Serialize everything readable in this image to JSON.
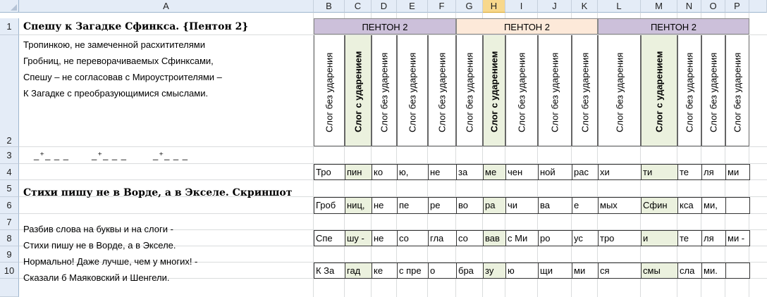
{
  "columns": [
    "A",
    "B",
    "C",
    "D",
    "E",
    "F",
    "G",
    "H",
    "I",
    "J",
    "K",
    "L",
    "M",
    "N",
    "O",
    "P"
  ],
  "selected_column": "H",
  "rows": [
    "1",
    "2",
    "3",
    "4",
    "5",
    "6",
    "7",
    "8",
    "9",
    "10"
  ],
  "cells": {
    "a1": "Спешу к Загадке Сфинкса. {Пентон 2}",
    "poem": [
      "Тропинкою, не замеченной расхитителями",
      "Гробниц, не переворачиваемых Сфинксами,",
      "Спешу – не согласовав с Мироустроителями –",
      "К Загадке с преобразующимися смыслами."
    ],
    "a3_meter": [
      "_⁺_ _ _",
      "_⁺_ _ _",
      "_⁺_ _ _"
    ],
    "a5": "Стихи пишу не в  Ворде,  а  в  Экселе. Скриншот",
    "a7": "Разбив слова на буквы и на слоги -",
    "a8": "Стихи пишу не в Ворде, а в Экселе.",
    "a9": "Нормально! Даже лучше, чем у многих! -",
    "a10": "Сказали  б  Маяковский и Шенгели."
  },
  "banners": [
    "ПЕНТОН 2",
    "ПЕНТОН 2",
    "ПЕНТОН 2"
  ],
  "vertical_labels": {
    "unstressed": "Слог  без  ударения",
    "stressed": "Слог  с  ударением"
  },
  "syllable_rows": {
    "r4": [
      "Тро",
      "пин",
      "ко",
      "ю,",
      "не",
      "за",
      "ме",
      "чен",
      "ной",
      "рас",
      "хи",
      "ти",
      "те",
      "ля",
      "ми"
    ],
    "r6": [
      "Гроб",
      "ниц,",
      "не",
      "пе",
      "ре",
      "во",
      "ра",
      "чи",
      "ва",
      "е",
      "мых",
      "Сфин",
      "кса",
      "ми,",
      ""
    ],
    "r8": [
      "Спе",
      "шу -",
      "не",
      "со",
      "гла",
      "со",
      "вав",
      "с Ми",
      "ро",
      "ус",
      "тро",
      "и",
      "те",
      "ля",
      "ми -"
    ],
    "r10": [
      "К За",
      "гад",
      "ке",
      "с пре",
      "о",
      "бра",
      "зу",
      "ю",
      "щи",
      "ми",
      "ся",
      "смы",
      "сла",
      "ми.",
      ""
    ]
  },
  "colors": {
    "banner_1": "#ccc0da",
    "banner_2": "#fde9d9",
    "stressed_fill": "#ebf1de",
    "header_fill": "#e4ecf7",
    "selected_header": "#f8d88c"
  }
}
